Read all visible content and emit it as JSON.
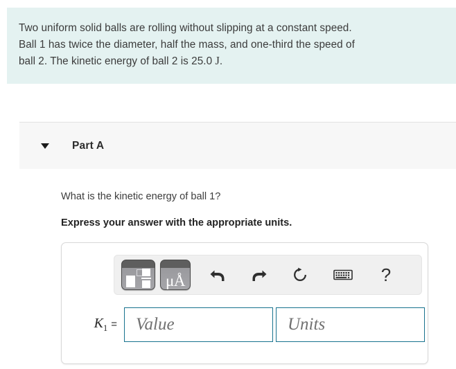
{
  "problem": {
    "line1": "Two uniform solid balls are rolling without slipping at a constant speed.",
    "line2": "Ball 1 has twice the diameter, half the mass, and one-third the speed of",
    "line3_pre": "ball 2. The kinetic energy of ball 2 is 25.0 ",
    "line3_unit": "J",
    "line3_post": ".",
    "background_color": "#e4f2f1"
  },
  "part": {
    "title": "Part A",
    "toggle_state": "expanded",
    "background_color": "#f7f7f7"
  },
  "question": {
    "prompt": "What is the kinetic energy of ball 1?",
    "instruction": "Express your answer with the appropriate units."
  },
  "toolbar": {
    "buttons": [
      {
        "name": "math-template-button",
        "label": ""
      },
      {
        "name": "units-button",
        "label": "μÅ"
      },
      {
        "name": "undo-button",
        "label": ""
      },
      {
        "name": "redo-button",
        "label": ""
      },
      {
        "name": "reset-button",
        "label": ""
      },
      {
        "name": "keyboard-button",
        "label": ""
      },
      {
        "name": "help-button",
        "label": "?"
      }
    ],
    "help_glyph": "?",
    "units_glyph": "μÅ",
    "background_color": "#f0f0f0"
  },
  "answer": {
    "variable": "K",
    "variable_subscript": "1",
    "equals": "=",
    "value_placeholder": "Value",
    "units_placeholder": "Units",
    "value_text": "",
    "units_text": "",
    "border_color": "#17728e"
  }
}
